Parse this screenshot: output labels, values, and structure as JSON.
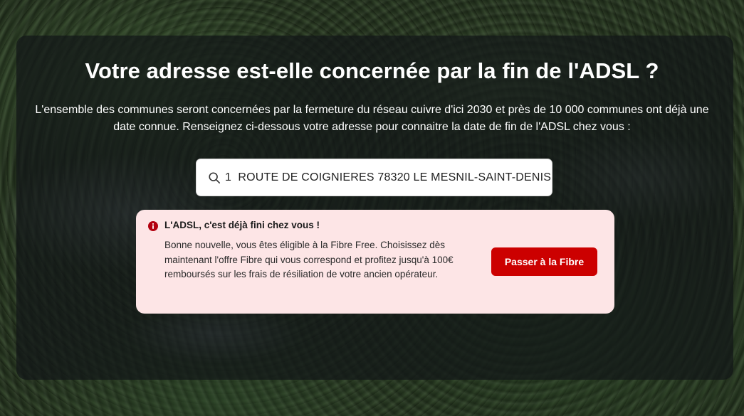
{
  "hero": {
    "title": "Votre adresse est-elle concernée par la fin de l'ADSL ?",
    "subtitle": "L'ensemble des communes seront concernées par la fermeture du réseau cuivre d'ici 2030 et près de 10 000 communes ont déjà une date connue. Renseignez ci-dessous votre adresse pour connaitre la date de fin de l'ADSL chez vous :"
  },
  "search": {
    "icon": "search-icon",
    "value": "1  ROUTE DE COIGNIERES 78320 LE MESNIL-SAINT-DENIS",
    "placeholder": ""
  },
  "alert": {
    "icon": "info-icon",
    "title": "L'ADSL, c'est déjà fini chez vous !",
    "body": "Bonne nouvelle, vous êtes éligible à la Fibre Free. Choisissez dès maintenant l'offre Fibre qui vous correspond et profitez jusqu'à 100€ remboursés sur les frais de résiliation de votre ancien opérateur.",
    "button_label": "Passer à la Fibre"
  },
  "colors": {
    "accent": "#cc0000",
    "alert_background": "#fde5e6",
    "panel_background": "#12161a"
  }
}
